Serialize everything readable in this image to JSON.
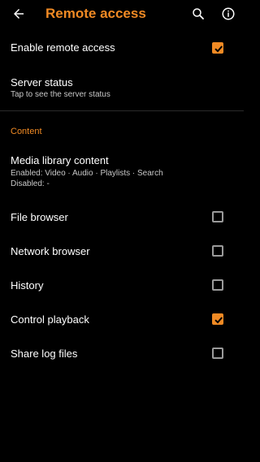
{
  "colors": {
    "accent": "#f08a24",
    "background": "#000000",
    "text_primary": "#ffffff",
    "text_secondary": "#c8c8c8"
  },
  "appbar": {
    "title": "Remote access",
    "back_icon": "arrow-back-icon",
    "search_icon": "search-icon",
    "info_icon": "info-icon"
  },
  "settings": {
    "enable_remote": {
      "label": "Enable remote access",
      "checked": true
    },
    "server_status": {
      "label": "Server status",
      "subtitle": "Tap to see the server status"
    },
    "content_header": "Content",
    "media_library": {
      "label": "Media library content",
      "enabled": "Enabled: Video · Audio · Playlists · Search",
      "disabled": "Disabled: -"
    },
    "file_browser": {
      "label": "File browser",
      "checked": false
    },
    "network_browser": {
      "label": "Network browser",
      "checked": false
    },
    "history": {
      "label": "History",
      "checked": false
    },
    "control_playback": {
      "label": "Control playback",
      "checked": true
    },
    "share_logs": {
      "label": "Share log files",
      "checked": false
    }
  }
}
